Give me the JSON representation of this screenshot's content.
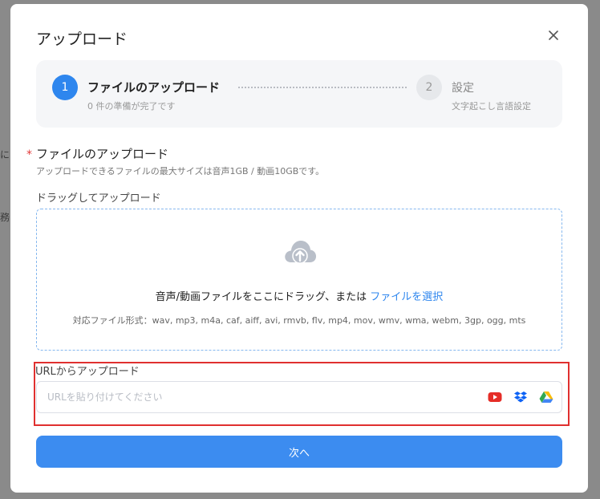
{
  "background": {
    "fragment_left1": "に",
    "fragment_left2": "務"
  },
  "modal": {
    "title": "アップロード",
    "close_icon": "close-icon"
  },
  "stepper": {
    "step1": {
      "number": "1",
      "title": "ファイルのアップロード",
      "subtitle": "0 件の準備が完了です"
    },
    "step2": {
      "number": "2",
      "title": "設定",
      "subtitle": "文字起こし言語設定"
    }
  },
  "file_section": {
    "required_mark": "*",
    "title": "ファイルのアップロード",
    "description": "アップロードできるファイルの最大サイズは音声1GB / 動画10GBです。",
    "drag_label": "ドラッグしてアップロード"
  },
  "dropzone": {
    "icon": "cloud-upload-icon",
    "instruction": "音声/動画ファイルをここにドラッグ、または",
    "link_label": "ファイルを選択",
    "formats": "対応ファイル形式：wav, mp3, m4a, caf, aiff, avi, rmvb, flv, mp4, mov, wmv, wma, webm, 3gp, ogg, mts"
  },
  "url_section": {
    "label": "URLからアップロード",
    "input_value": "",
    "placeholder": "URLを貼り付けてください",
    "icons": [
      "youtube-icon",
      "dropbox-icon",
      "google-drive-icon"
    ]
  },
  "footer": {
    "next_label": "次へ"
  },
  "colors": {
    "accent": "#2e86ee",
    "button": "#3c8cf0",
    "highlight": "#e0302f",
    "required": "#e23a3a"
  }
}
